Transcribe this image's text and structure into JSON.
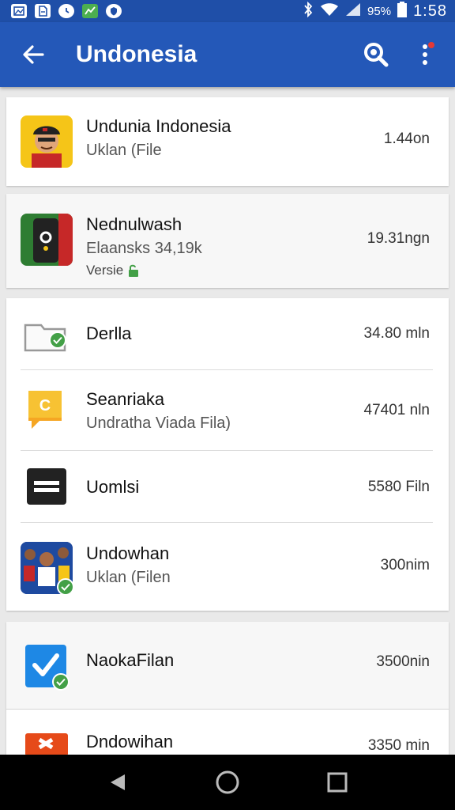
{
  "status_bar": {
    "battery_percent": "95%",
    "time": "1:58"
  },
  "app_bar": {
    "title": "Undonesia"
  },
  "items": [
    {
      "title": "Undunia Indonesia",
      "subtitle": "Uklan (File",
      "value": "1.44on",
      "icon": "avatar-cap-icon"
    },
    {
      "title": "Nednulwash",
      "subtitle": "Elaansks 34,19k",
      "extra": "Versie",
      "value": "19.31ngn",
      "icon": "phone-app-icon"
    },
    {
      "title": "Derlla",
      "value": "34.80 mln",
      "icon": "folder-check-icon"
    },
    {
      "title": "Seanriaka",
      "subtitle": "Undratha Viada Fila)",
      "value": "47401 nln",
      "icon": "letter-c-icon"
    },
    {
      "title": "Uomlsi",
      "value": "5580 Filn",
      "icon": "document-box-icon"
    },
    {
      "title": "Undowhan",
      "subtitle": "Uklan (Filen",
      "value": "300nim",
      "icon": "people-photo-icon"
    },
    {
      "title": "NaokaFilan",
      "value": "3500nin",
      "icon": "checkbox-icon"
    },
    {
      "title": "Dndowihan",
      "value": "3350 min",
      "icon": "orange-app-icon"
    }
  ],
  "colors": {
    "app_bar": "#2458b8",
    "status_bar": "#1f4fa8",
    "check_green": "#43a047"
  }
}
